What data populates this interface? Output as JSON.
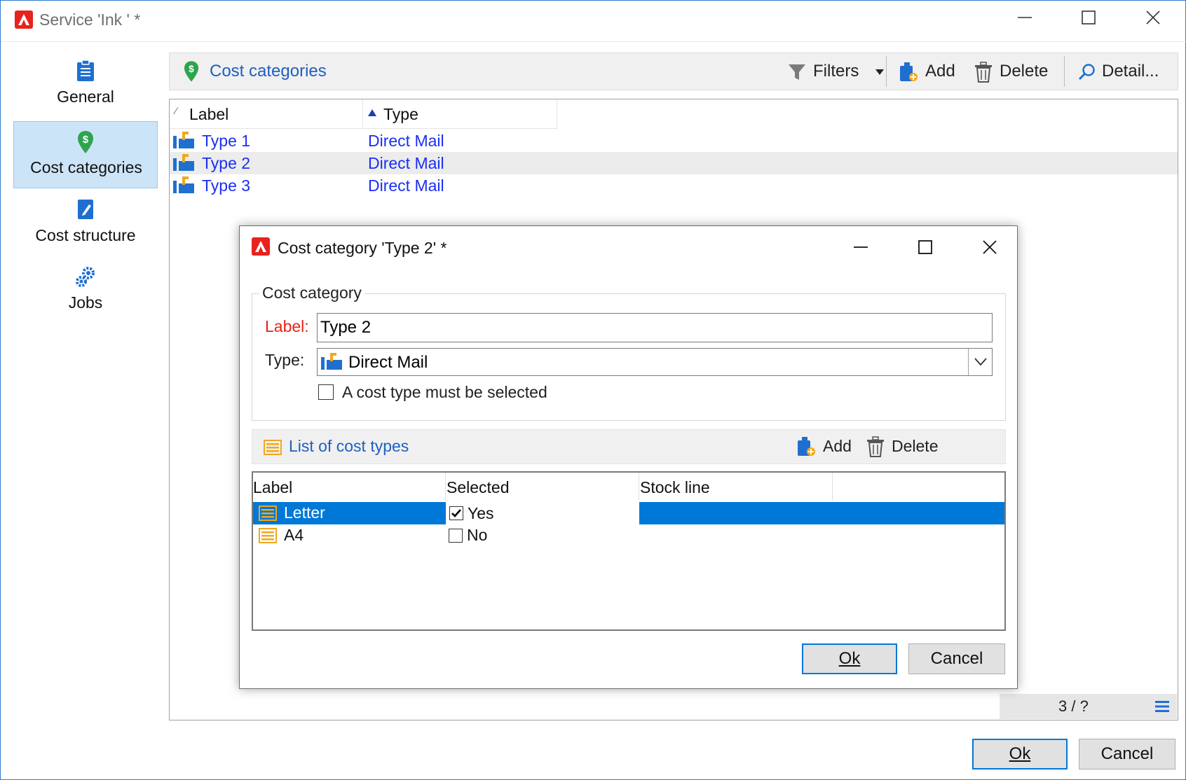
{
  "window": {
    "title": "Service 'Ink ' *",
    "controls": {
      "minimize": "—",
      "maximize": "☐",
      "close": "✕"
    }
  },
  "nav": {
    "items": [
      {
        "label": "General",
        "icon": "clipboard-icon"
      },
      {
        "label": "Cost categories",
        "icon": "money-pin-icon",
        "selected": true
      },
      {
        "label": "Cost structure",
        "icon": "document-edit-icon"
      },
      {
        "label": "Jobs",
        "icon": "gears-icon"
      }
    ]
  },
  "toolbar": {
    "title": "Cost categories",
    "filters": "Filters",
    "add": "Add",
    "delete": "Delete",
    "detail": "Detail..."
  },
  "grid": {
    "columns": [
      "Label",
      "Type"
    ],
    "rows": [
      {
        "label": "Type 1",
        "type": "Direct Mail"
      },
      {
        "label": "Type 2",
        "type": "Direct Mail"
      },
      {
        "label": "Type 3",
        "type": "Direct Mail"
      }
    ],
    "status": "3 / ?"
  },
  "footer": {
    "ok": "Ok",
    "cancel": "Cancel"
  },
  "dialog": {
    "title": "Cost category 'Type 2' *",
    "group_title": "Cost category",
    "label_caption": "Label:",
    "label_value": "Type 2",
    "type_caption": "Type:",
    "type_value": "Direct Mail",
    "must_select": "A cost type must be selected",
    "list_title": "List of cost types",
    "add": "Add",
    "delete": "Delete",
    "columns": [
      "Label",
      "Selected",
      "Stock line"
    ],
    "rows": [
      {
        "label": "Letter",
        "selected": "Yes",
        "checked": true,
        "stock_line": ""
      },
      {
        "label": "A4",
        "selected": "No",
        "checked": false,
        "stock_line": ""
      }
    ],
    "ok": "Ok",
    "cancel": "Cancel"
  },
  "colors": {
    "accent": "#0078d7",
    "link": "#1b2ff5",
    "nav_selected": "#cce4f7",
    "required_label": "#e8221c",
    "list_icon": "#f0a81d"
  }
}
